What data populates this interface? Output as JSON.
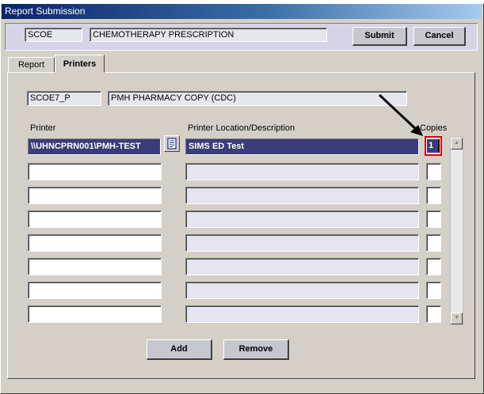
{
  "window": {
    "title": "Report Submission"
  },
  "header": {
    "code": "SCOE",
    "name": "CHEMOTHERAPY PRESCRIPTION",
    "submit_label": "Submit",
    "cancel_label": "Cancel"
  },
  "tabs": [
    {
      "label": "Report",
      "active": false
    },
    {
      "label": "Printers",
      "active": true
    }
  ],
  "copy": {
    "code": "SCOE7_P",
    "description": "PMH PHARMACY COPY (CDC)"
  },
  "columns": {
    "printer": "Printer",
    "location": "Printer Location/Description",
    "copies": "Copies"
  },
  "rows": [
    {
      "printer": "\\\\UHNCPRN001\\PMH-TEST",
      "location": "SIMS ED Test",
      "copies": "1",
      "selected": true
    },
    {
      "printer": "",
      "location": "",
      "copies": ""
    },
    {
      "printer": "",
      "location": "",
      "copies": ""
    },
    {
      "printer": "",
      "location": "",
      "copies": ""
    },
    {
      "printer": "",
      "location": "",
      "copies": ""
    },
    {
      "printer": "",
      "location": "",
      "copies": ""
    },
    {
      "printer": "",
      "location": "",
      "copies": ""
    },
    {
      "printer": "",
      "location": "",
      "copies": ""
    }
  ],
  "actions": {
    "add_label": "Add",
    "remove_label": "Remove"
  },
  "icons": {
    "lookup": "document-lookup-icon",
    "annotation": "arrow-annotation-icon"
  },
  "colors": {
    "selected_row": "#3c3c78",
    "highlight_box": "#e00000"
  }
}
